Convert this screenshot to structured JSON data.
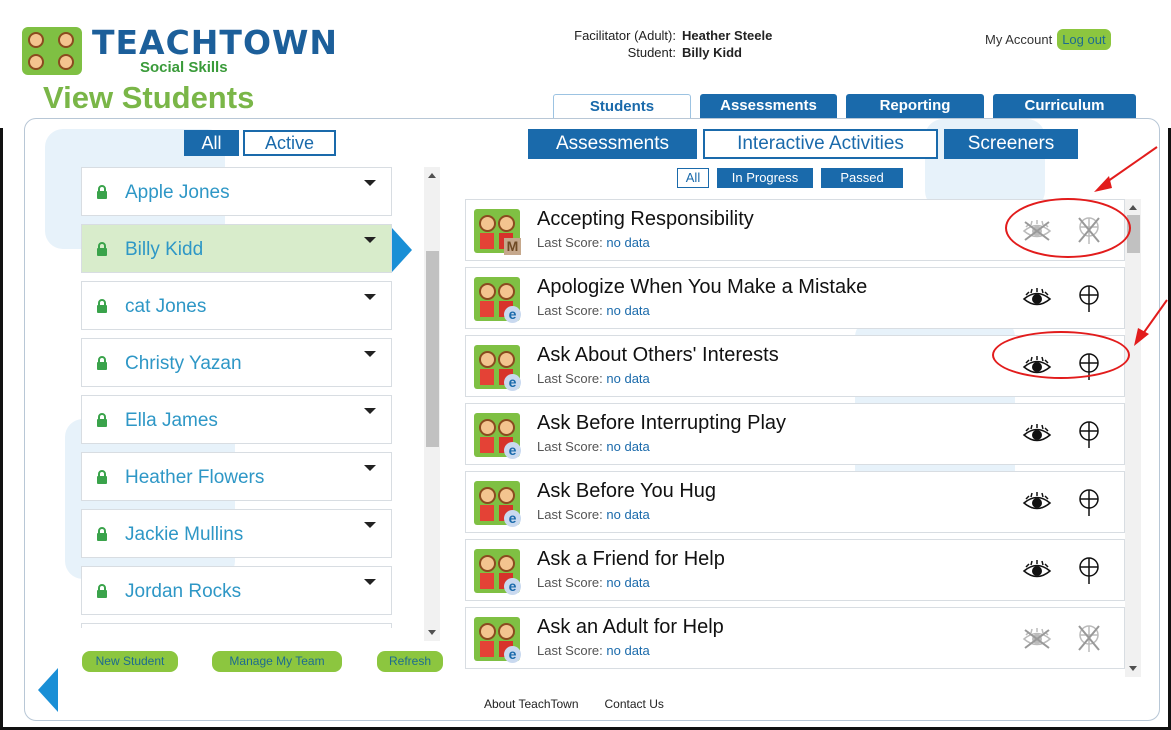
{
  "logo": {
    "title": "TEACHTOWN",
    "subtitle": "Social Skills"
  },
  "page_title": "View Students",
  "facilitator": {
    "facilitator_label": "Facilitator (Adult):",
    "facilitator_name": "Heather Steele",
    "student_label": "Student:",
    "student_name": "Billy Kidd"
  },
  "account": {
    "my_account": "My Account",
    "logout": "Log out"
  },
  "main_tabs": [
    "Students",
    "Assessments",
    "Reporting",
    "Curriculum"
  ],
  "left_filter": {
    "all": "All",
    "active": "Active"
  },
  "students": [
    {
      "name": "Apple Jones",
      "selected": false
    },
    {
      "name": "Billy Kidd",
      "selected": true
    },
    {
      "name": "cat Jones",
      "selected": false
    },
    {
      "name": "Christy Yazan",
      "selected": false
    },
    {
      "name": "Ella James",
      "selected": false
    },
    {
      "name": "Heather Flowers",
      "selected": false
    },
    {
      "name": "Jackie Mullins",
      "selected": false
    },
    {
      "name": "Jordan Rocks",
      "selected": false
    },
    {
      "name": "",
      "selected": false
    }
  ],
  "left_buttons": {
    "new_student": "New Student",
    "manage_team": "Manage My Team",
    "refresh": "Refresh"
  },
  "sub_tabs": [
    "Assessments",
    "Interactive Activities",
    "Screeners"
  ],
  "status_filter": [
    "All",
    "In Progress",
    "Passed"
  ],
  "score_label": "Last Score:",
  "activities": [
    {
      "title": "Accepting Responsibility",
      "score": "no data",
      "badge": "M",
      "enabled": false
    },
    {
      "title": "Apologize When You Make a Mistake",
      "score": "no data",
      "badge": "e",
      "enabled": true
    },
    {
      "title": "Ask About Others' Interests",
      "score": "no data",
      "badge": "e",
      "enabled": true
    },
    {
      "title": "Ask Before Interrupting Play",
      "score": "no data",
      "badge": "e",
      "enabled": true
    },
    {
      "title": "Ask Before You Hug",
      "score": "no data",
      "badge": "e",
      "enabled": true
    },
    {
      "title": "Ask a Friend for Help",
      "score": "no data",
      "badge": "e",
      "enabled": true
    },
    {
      "title": "Ask an Adult for Help",
      "score": "no data",
      "badge": "e",
      "enabled": false
    }
  ],
  "footer": {
    "about": "About TeachTown",
    "contact": "Contact Us"
  },
  "colors": {
    "primary": "#1a6aab",
    "green": "#8cc63f",
    "title_green": "#7ab648",
    "link": "#2e97c6",
    "annotation": "#e21c1c"
  }
}
